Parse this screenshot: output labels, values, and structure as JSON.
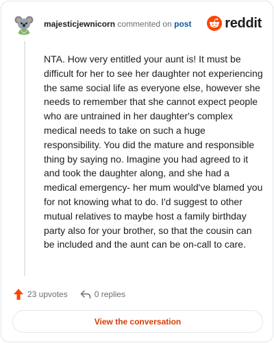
{
  "header": {
    "username": "majesticjewnicorn",
    "action": "commented on",
    "post_link": "post",
    "brand": "reddit",
    "avatar_icon": "koala-avatar-icon"
  },
  "comment": {
    "text": "NTA. How very entitled your aunt is! It must be difficult for her to see her daughter not experiencing the same social life as everyone else, however she needs to remember that she cannot expect people who are untrained in her daughter's complex medical needs to take on such a huge responsibility. You did the mature and responsible thing by saying no. Imagine you had agreed to it and took the daughter along, and she had a medical emergency- her mum would've blamed you for not knowing what to do. I'd suggest to other mutual relatives to maybe host a family birthday party also for your brother, so that the cousin can be included and the aunt can be on-call to care."
  },
  "footer": {
    "upvotes": "23 upvotes",
    "replies": "0 replies"
  },
  "cta": {
    "label": "View the conversation"
  },
  "colors": {
    "brand_orange": "#ff4500",
    "cta_text": "#d93a00",
    "link_blue": "#0a58a6",
    "muted_text": "#6a6e72",
    "border": "#e3e5e8"
  }
}
